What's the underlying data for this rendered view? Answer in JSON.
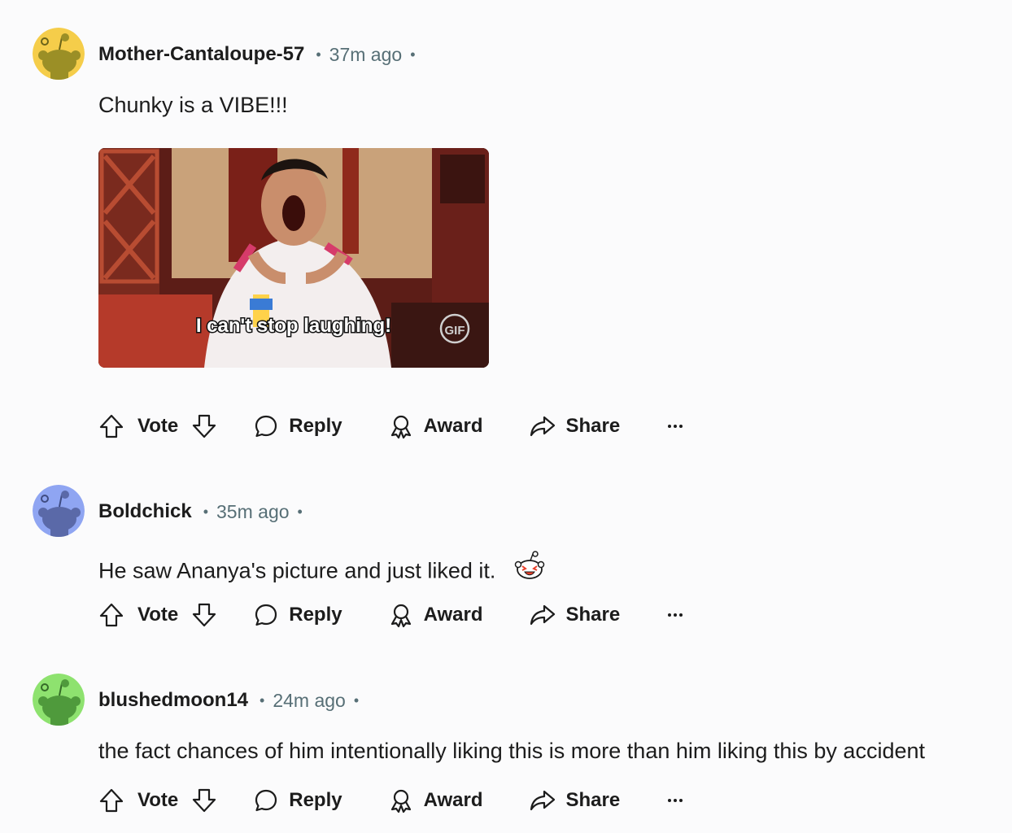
{
  "comments": [
    {
      "username": "Mother-Cantaloupe-57",
      "time": "37m ago",
      "text": "Chunky is a VIBE!!!",
      "avatar_color": "#f5cd4a",
      "gif": {
        "caption": "I can't stop laughing!",
        "badge": "GIF"
      }
    },
    {
      "username": "Boldchick",
      "time": "35m ago",
      "text": "He saw Ananya's picture and just liked it.",
      "avatar_color": "#8fa5f2",
      "emoji": "snoo-laugh-icon"
    },
    {
      "username": "blushedmoon14",
      "time": "24m ago",
      "text": "the fact chances of him intentionally liking this is more than him liking this by accident",
      "avatar_color": "#8ee26f"
    }
  ],
  "actions": {
    "vote": "Vote",
    "reply": "Reply",
    "award": "Award",
    "share": "Share"
  },
  "separator": "•"
}
